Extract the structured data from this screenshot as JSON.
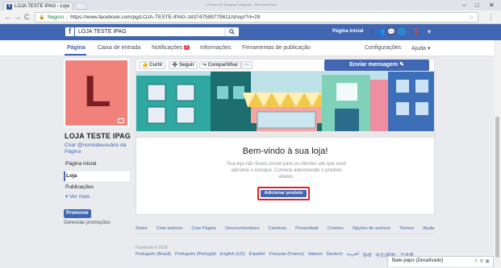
{
  "browser": {
    "tab_title": "LOJA TESTE IPAG - Loja",
    "tab_close": "×",
    "tab_hint": "Criação de Shopping Instagram - Microsoft Word",
    "window_minimize": "–",
    "window_maximize": "□",
    "window_close": "✕",
    "nav_back": "←",
    "nav_forward": "→",
    "nav_reload": "C",
    "secure_label": "Seguro",
    "url": "https://www.facebook.com/pg/LOJA-TESTE-IPAG-183747599779811/shop/?rt=29",
    "menu_icon": "⋮"
  },
  "fb_topbar": {
    "logo": "f",
    "search_value": "LOJA TESTE IPAG",
    "home_link": "Página inicial"
  },
  "page_nav": {
    "items": [
      "Página",
      "Caixa de entrada",
      "Notificações",
      "Informações",
      "Ferramentas de publicação"
    ],
    "notification_badge": "1",
    "settings": "Configurações",
    "help": "Ajuda ▾"
  },
  "left": {
    "profile_letter": "L",
    "page_name": "LOJA TESTE IPAG",
    "username": "Criar @nomedeusuário da Página",
    "nav": [
      "Página inicial",
      "Loja",
      "Publicações",
      "▾ Ver mais"
    ],
    "promote_button": "Promover",
    "manage_promotions": "Gerenciar promoções"
  },
  "actions": {
    "like": "Curtir",
    "follow": "Seguir",
    "share": "Compartilhar",
    "more": "···",
    "send_message": "Enviar mensagem"
  },
  "shop": {
    "title": "Bem-vindo à sua loja!",
    "description": "Sua loja não ficará visível para os clientes até que você adicione o estoque. Comece adicionando o produto abaixo.",
    "add_product_button": "Adicionar produto"
  },
  "footer": {
    "links": [
      "Sobre",
      "Criar anúncio",
      "Criar Página",
      "Desenvolvedores",
      "Carreiras",
      "Privacidade",
      "Cookies",
      "Opções de anúncio",
      "Termos",
      "Ajuda"
    ],
    "copyright": "Facebook © 2018",
    "languages": [
      "Português (Brasil)",
      "Português (Portugal)",
      "English (US)",
      "Español",
      "Français (France)",
      "Italiano",
      "Deutsch",
      "العربية",
      "हिन्दी",
      "中文(简体)",
      "日本語"
    ]
  },
  "chat": {
    "label": "Bate-papo (Desativado)"
  },
  "colors": {
    "fb_blue": "#4267b2",
    "profile_bg": "#f0827b",
    "highlight_red": "#d9252a"
  }
}
